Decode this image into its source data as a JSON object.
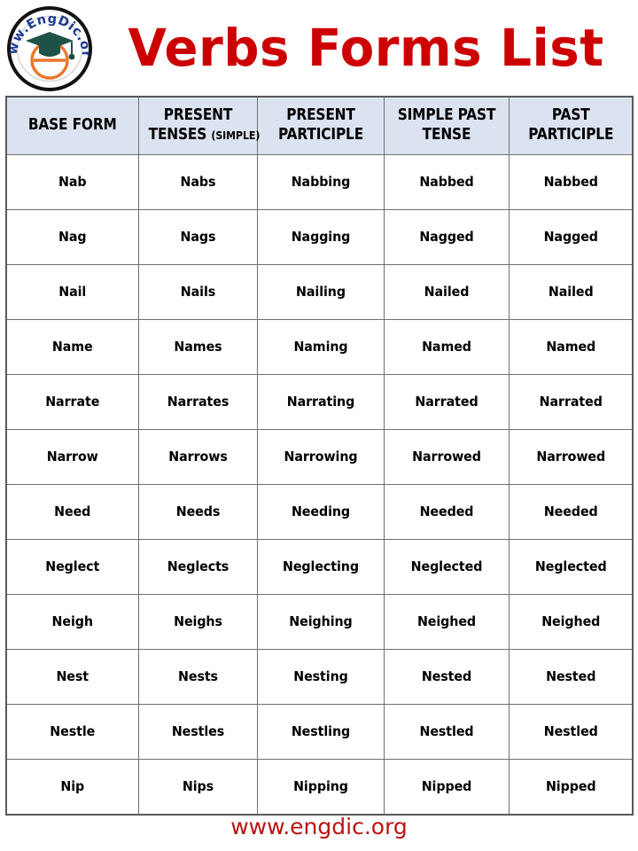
{
  "header": {
    "title": "Verbs Forms List",
    "title_color": "#cc0000",
    "logo": {
      "name": "engdic-logo",
      "curved_text": "www.EngDic.org",
      "letter": "e",
      "cap_color": "#1d5247",
      "letter_color": "#e8762c",
      "text_color": "#1f3a93"
    }
  },
  "table": {
    "header_bg": "#dce3f0",
    "border_color": "#6f6f6f",
    "columns": [
      {
        "line1": "BASE FORM",
        "line2": "",
        "small": ""
      },
      {
        "line1": "PRESENT",
        "line2": "TENSES ",
        "small": "(SIMPLE)"
      },
      {
        "line1": "PRESENT",
        "line2": "PARTICIPLE",
        "small": ""
      },
      {
        "line1": "SIMPLE PAST",
        "line2": "TENSE",
        "small": ""
      },
      {
        "line1": "PAST",
        "line2": "PARTICIPLE",
        "small": ""
      }
    ],
    "rows": [
      [
        "Nab",
        "Nabs",
        "Nabbing",
        "Nabbed",
        "Nabbed"
      ],
      [
        "Nag",
        "Nags",
        "Nagging",
        "Nagged",
        "Nagged"
      ],
      [
        "Nail",
        "Nails",
        "Nailing",
        "Nailed",
        "Nailed"
      ],
      [
        "Name",
        "Names",
        "Naming",
        "Named",
        "Named"
      ],
      [
        "Narrate",
        "Narrates",
        "Narrating",
        "Narrated",
        "Narrated"
      ],
      [
        "Narrow",
        "Narrows",
        "Narrowing",
        "Narrowed",
        "Narrowed"
      ],
      [
        "Need",
        "Needs",
        "Needing",
        "Needed",
        "Needed"
      ],
      [
        "Neglect",
        "Neglects",
        "Neglecting",
        "Neglected",
        "Neglected"
      ],
      [
        "Neigh",
        "Neighs",
        "Neighing",
        "Neighed",
        "Neighed"
      ],
      [
        "Nest",
        "Nests",
        "Nesting",
        "Nested",
        "Nested"
      ],
      [
        "Nestle",
        "Nestles",
        "Nestling",
        "Nestled",
        "Nestled"
      ],
      [
        "Nip",
        "Nips",
        "Nipping",
        "Nipped",
        "Nipped"
      ]
    ]
  },
  "footer": {
    "text": "www.engdic.org",
    "color": "#bb1414"
  }
}
